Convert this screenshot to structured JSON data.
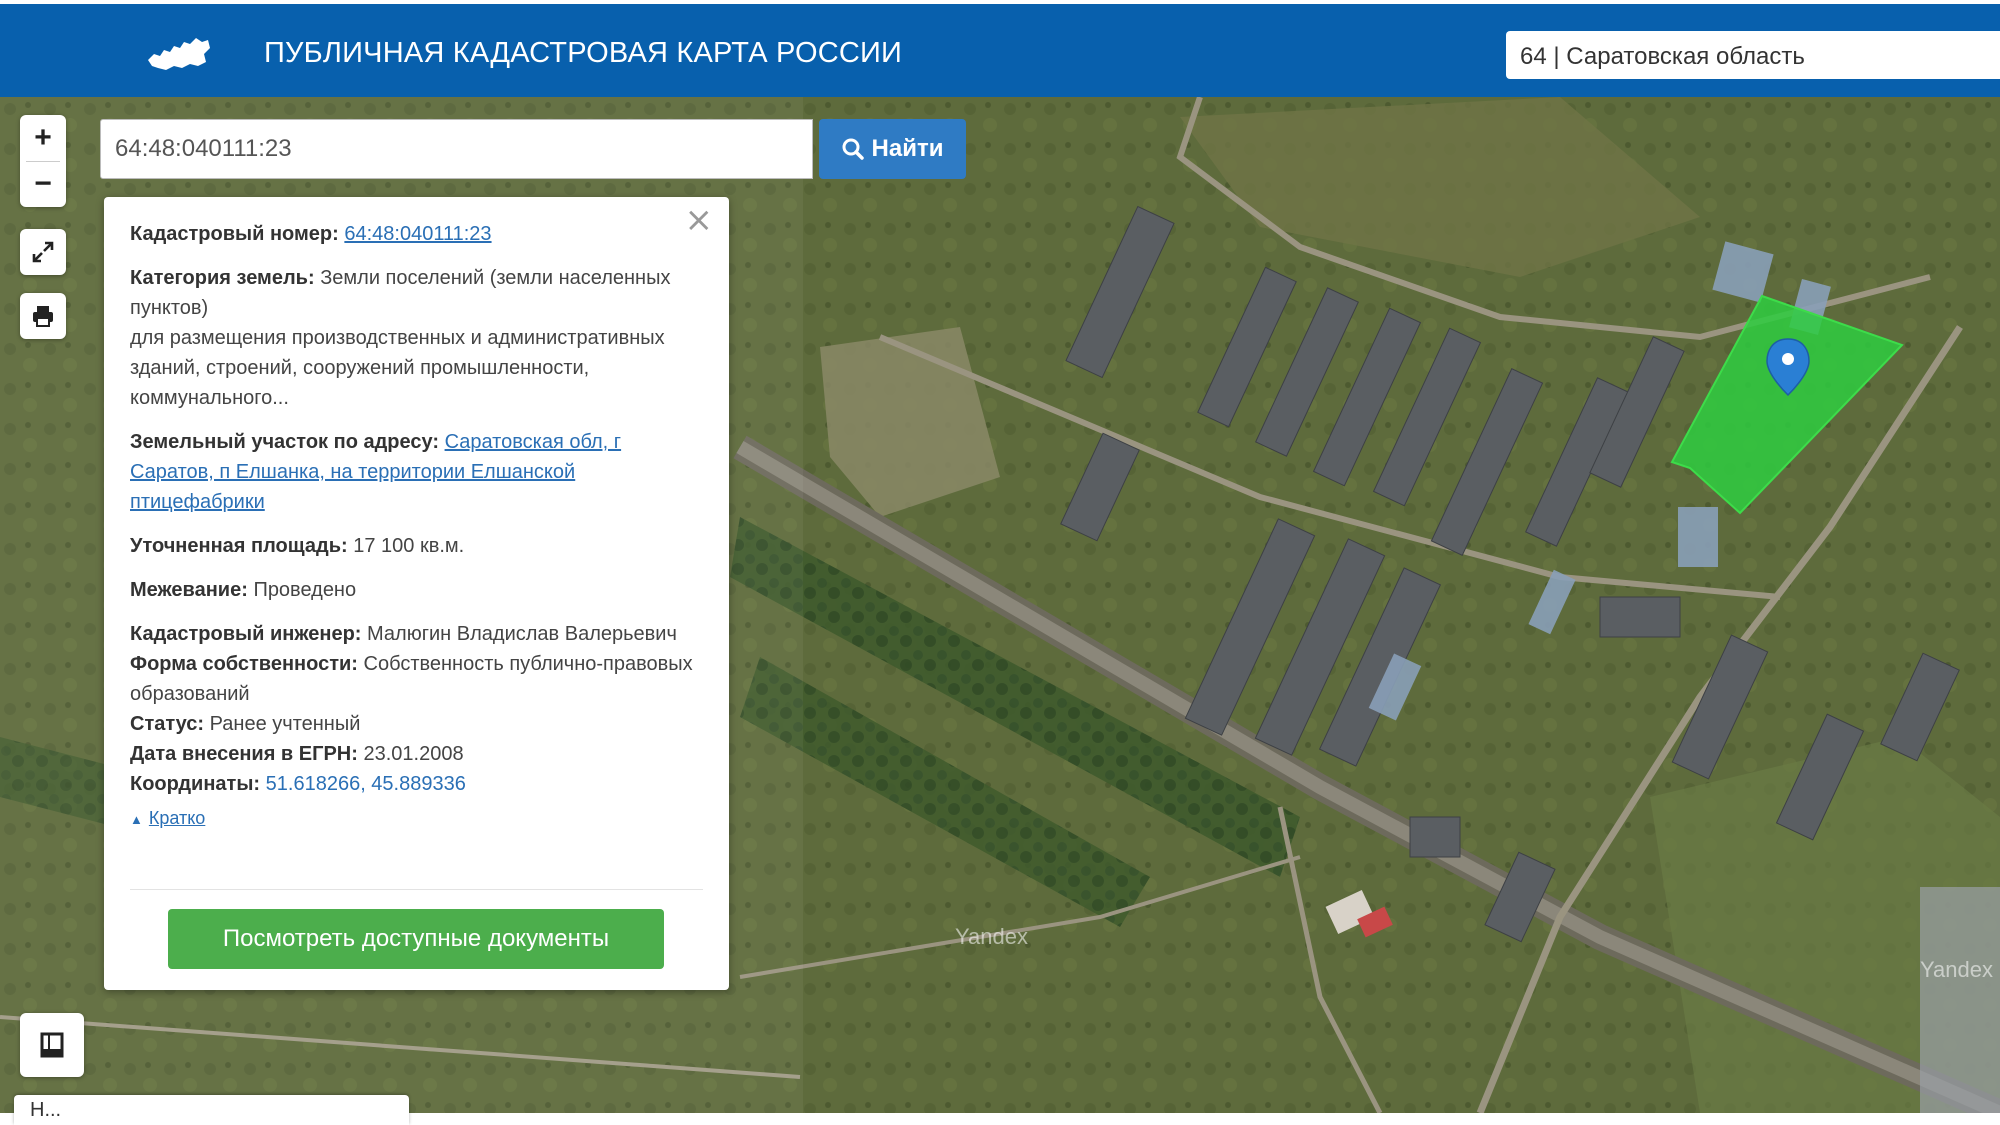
{
  "header": {
    "title": "ПУБЛИЧНАЯ КАДАСТРОВАЯ КАРТА РОССИИ",
    "region": "64 | Саратовская область",
    "logo_icon": "russia-map-icon",
    "background": "#0860ad"
  },
  "search": {
    "value": "64:48:040111:23",
    "button_label": "Найти",
    "button_icon": "search-icon"
  },
  "controls": {
    "zoom_in": "+",
    "zoom_out": "−",
    "fullscreen_icon": "expand-icon",
    "print_icon": "printer-icon",
    "layers_icon": "layers-icon"
  },
  "panel": {
    "cadastral_number_label": "Кадастровый номер:",
    "cadastral_number": "64:48:040111:23",
    "land_category_label": "Категория земель:",
    "land_category": "Земли поселений (земли населенных пунктов)",
    "permitted_use": "для размещения производственных и административных зданий, строений, сооружений промышленности, коммунального...",
    "address_label": "Земельный участок по адресу:",
    "address": "Саратовская обл, г Саратов, п Елшанка, на территории Елшанской птицефабрики",
    "area_label": "Уточненная площадь:",
    "area": "17 100 кв.м.",
    "survey_label": "Межевание:",
    "survey": "Проведено",
    "engineer_label": "Кадастровый инженер:",
    "engineer": "Малюгин Владислав Валерьевич",
    "ownership_label": "Форма собственности:",
    "ownership": "Собственность публично-правовых образований",
    "status_label": "Статус:",
    "status": "Ранее учтенный",
    "date_label": "Дата внесения в ЕГРН:",
    "date": "23.01.2008",
    "coords_label": "Координаты:",
    "coords": "51.618266, 45.889336",
    "brief_label": "Кратко",
    "docs_button": "Посмотреть доступные документы",
    "close_icon": "close-icon"
  },
  "map": {
    "watermark_1": "Yandex",
    "watermark_2": "Yandex",
    "parcel_color": "#2ecc40",
    "marker_color": "#2a7fd4"
  },
  "bottom_strip": {
    "text": "Н..."
  }
}
